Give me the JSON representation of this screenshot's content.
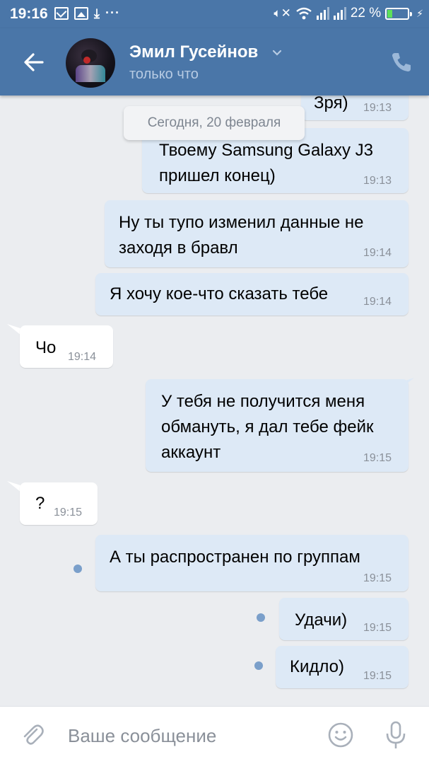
{
  "status_bar": {
    "time": "19:16",
    "more": "···",
    "battery_percent": "22 %",
    "battery_level": 0.22
  },
  "header": {
    "contact_name": "Эмил Гусейнов",
    "status": "только что"
  },
  "date_separator": "Сегодня, 20 февраля",
  "messages": [
    {
      "direction": "out",
      "lines": [
        "Зря)"
      ],
      "time": "19:13"
    },
    {
      "direction": "out",
      "lines": [
        "Твоему Samsung Galaxy J3",
        "пришел конец)"
      ],
      "time": "19:13"
    },
    {
      "direction": "out",
      "lines": [
        "Ну ты тупо изменил данные не",
        "заходя в бравл"
      ],
      "time": "19:14"
    },
    {
      "direction": "out",
      "lines": [
        "Я хочу кое-что сказать тебе"
      ],
      "time": "19:14"
    },
    {
      "direction": "in",
      "lines": [
        "Чо"
      ],
      "time": "19:14"
    },
    {
      "direction": "out",
      "lines": [
        "У тебя не получится меня",
        "обмануть, я дал тебе фейк",
        "аккаунт"
      ],
      "time": "19:15"
    },
    {
      "direction": "in",
      "lines": [
        "?"
      ],
      "time": "19:15"
    },
    {
      "direction": "out",
      "lines": [
        "А ты распространен по группам"
      ],
      "time": "19:15",
      "unread": true
    },
    {
      "direction": "out",
      "lines": [
        "Удачи)"
      ],
      "time": "19:15",
      "unread": true
    },
    {
      "direction": "out",
      "lines": [
        "Кидло)"
      ],
      "time": "19:15",
      "unread": true
    }
  ],
  "composer": {
    "placeholder": "Ваше сообщение"
  },
  "colors": {
    "header_bg": "#4a76a8",
    "outgoing_bubble": "#dde9f6",
    "incoming_bubble": "#ffffff",
    "chat_bg": "#ebedf0",
    "unread_dot": "#7a9fca"
  }
}
